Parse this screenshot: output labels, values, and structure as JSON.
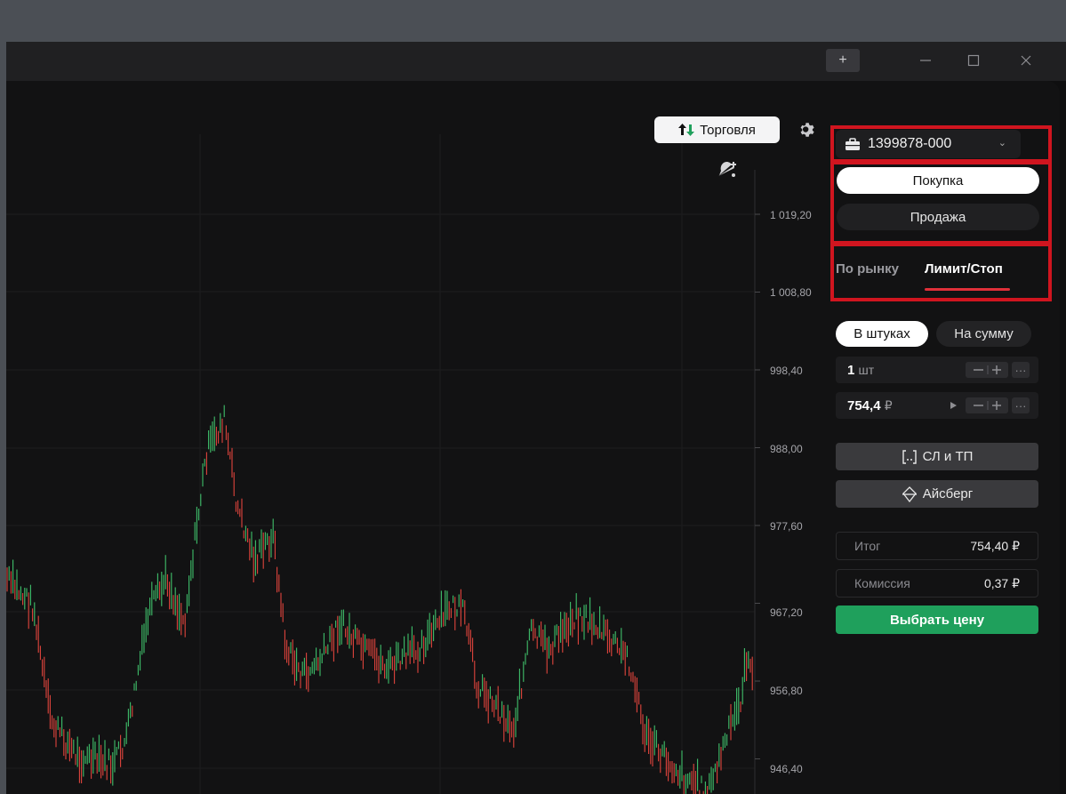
{
  "window": {
    "buttons": {
      "new_tab": "+",
      "minimize": "—",
      "maximize": "☐",
      "close": "✕"
    }
  },
  "chart": {
    "trade_button_label": "Торговля",
    "price_labels": [
      "1 019,20",
      "1 008,80",
      "998,40",
      "988,00",
      "977,60",
      "967,20",
      "956,80",
      "946,40"
    ]
  },
  "order_panel": {
    "account": "1399878-000",
    "buy_label": "Покупка",
    "sell_label": "Продажа",
    "tab_market": "По рынку",
    "tab_limit": "Лимит/Стоп",
    "mode_qty": "В штуках",
    "mode_sum": "На сумму",
    "qty_value": "1",
    "qty_unit": "шт",
    "price_value": "754,4",
    "price_unit": "₽",
    "sltp_label": "СЛ и ТП",
    "iceberg_label": "Айсберг",
    "total_label": "Итог",
    "total_value": "754,40 ₽",
    "fee_label": "Комиссия",
    "fee_value": "0,37 ₽",
    "choose_price_label": "Выбрать цену"
  },
  "colors": {
    "up": "#3fbf6a",
    "down": "#e0443c",
    "accent_green": "#1fa05c",
    "highlight_red": "#d0151f"
  }
}
